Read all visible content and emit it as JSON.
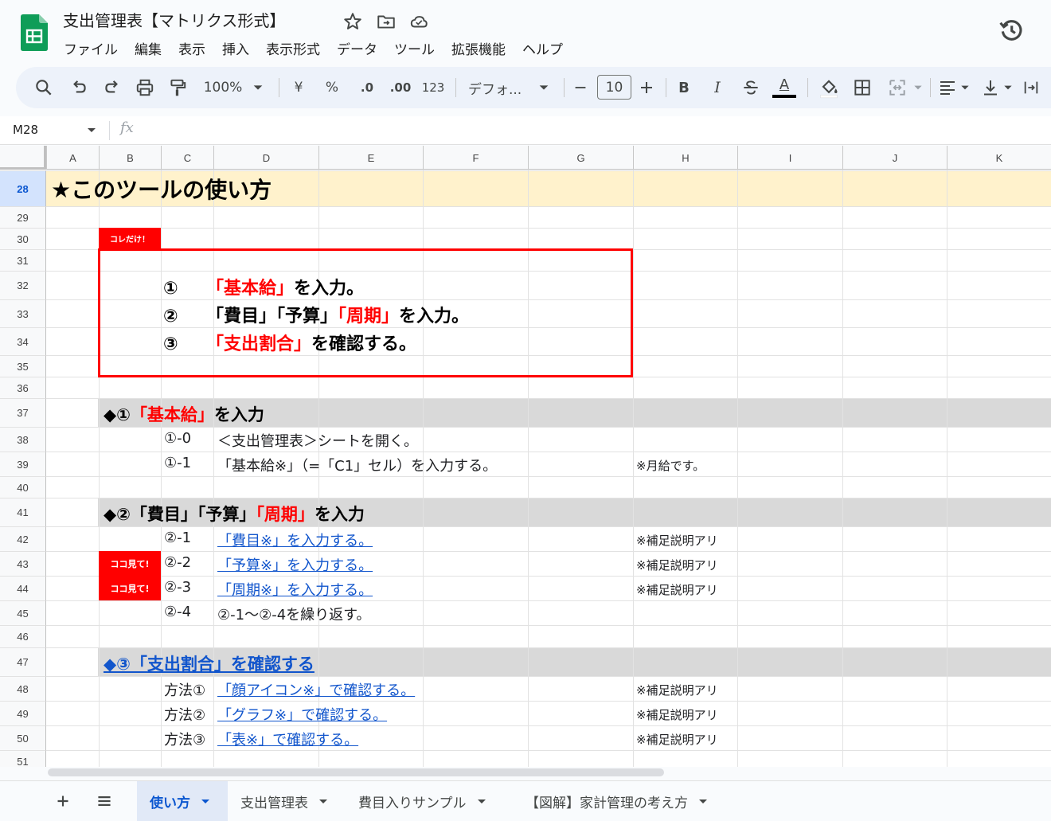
{
  "app": {
    "title": "支出管理表【マトリクス形式】",
    "menu": [
      "ファイル",
      "編集",
      "表示",
      "挿入",
      "表示形式",
      "データ",
      "ツール",
      "拡張機能",
      "ヘルプ"
    ]
  },
  "toolbar": {
    "zoom": "100%",
    "currency": "¥",
    "percent": "%",
    "decimal_decrease": ".0",
    "decimal_increase": ".00",
    "number_format": "123",
    "font": "デフォ...",
    "font_size": "10",
    "bold": "B",
    "italic": "I",
    "text_color": "A"
  },
  "formula_bar": {
    "cell_ref": "M28",
    "fx": "fx",
    "value": ""
  },
  "columns": [
    "A",
    "B",
    "C",
    "D",
    "E",
    "F",
    "G",
    "H",
    "I",
    "J",
    "K"
  ],
  "rows": [
    "28",
    "29",
    "30",
    "31",
    "32",
    "33",
    "34",
    "35",
    "36",
    "37",
    "38",
    "39",
    "40",
    "41",
    "42",
    "43",
    "44",
    "45",
    "46",
    "47",
    "48",
    "49",
    "50",
    "51"
  ],
  "colors": {
    "accent": "#0b57d0",
    "red": "#ff0000",
    "link": "#1155cc",
    "header_yellow": "#fff2cc",
    "section_gray": "#d9d9d9"
  },
  "sheet": {
    "title": "★このツールの使い方",
    "badge_kore": "コレだけ！",
    "badge_koko": "ココ見て!",
    "howto": [
      {
        "num": "①",
        "red": "「基本給」",
        "rest": "を入力。"
      },
      {
        "num": "②",
        "pre": "「費目」「予算」",
        "red": "「周期」",
        "rest": "を入力。"
      },
      {
        "num": "③",
        "red": "「支出割合」",
        "rest": "を確認する。"
      }
    ],
    "sec1": {
      "pre": "◆①",
      "red": "「基本給」",
      "rest": "を入力"
    },
    "step1_0": {
      "num": "①-0",
      "text": "＜支出管理表＞シートを開く。"
    },
    "step1_1": {
      "num": "①-1",
      "text": "「基本給※」（=「C1」セル）を入力する。",
      "note": "※月給です。"
    },
    "sec2": {
      "pre": "◆②「費目」「予算」",
      "red": "「周期」",
      "rest": "を入力"
    },
    "step2_1": {
      "num": "②-1",
      "text": "「費目※」を入力する。",
      "note": "※補足説明アリ"
    },
    "step2_2": {
      "num": "②-2",
      "text": "「予算※」を入力する。",
      "note": "※補足説明アリ"
    },
    "step2_3": {
      "num": "②-3",
      "text": "「周期※」を入力する。",
      "note": "※補足説明アリ"
    },
    "step2_4": {
      "num": "②-4",
      "text": "②-1〜②-4を繰り返す。"
    },
    "sec3": {
      "text": "◆③「支出割合」を確認する"
    },
    "method1": {
      "num": "方法①",
      "text": "「顔アイコン※」で確認する。",
      "note": "※補足説明アリ"
    },
    "method2": {
      "num": "方法②",
      "text": "「グラフ※」で確認する。",
      "note": "※補足説明アリ"
    },
    "method3": {
      "num": "方法③",
      "text": "「表※」で確認する。",
      "note": "※補足説明アリ"
    }
  },
  "tabs": [
    "使い方",
    "支出管理表",
    "費目入りサンプル",
    "【図解】家計管理の考え方"
  ]
}
